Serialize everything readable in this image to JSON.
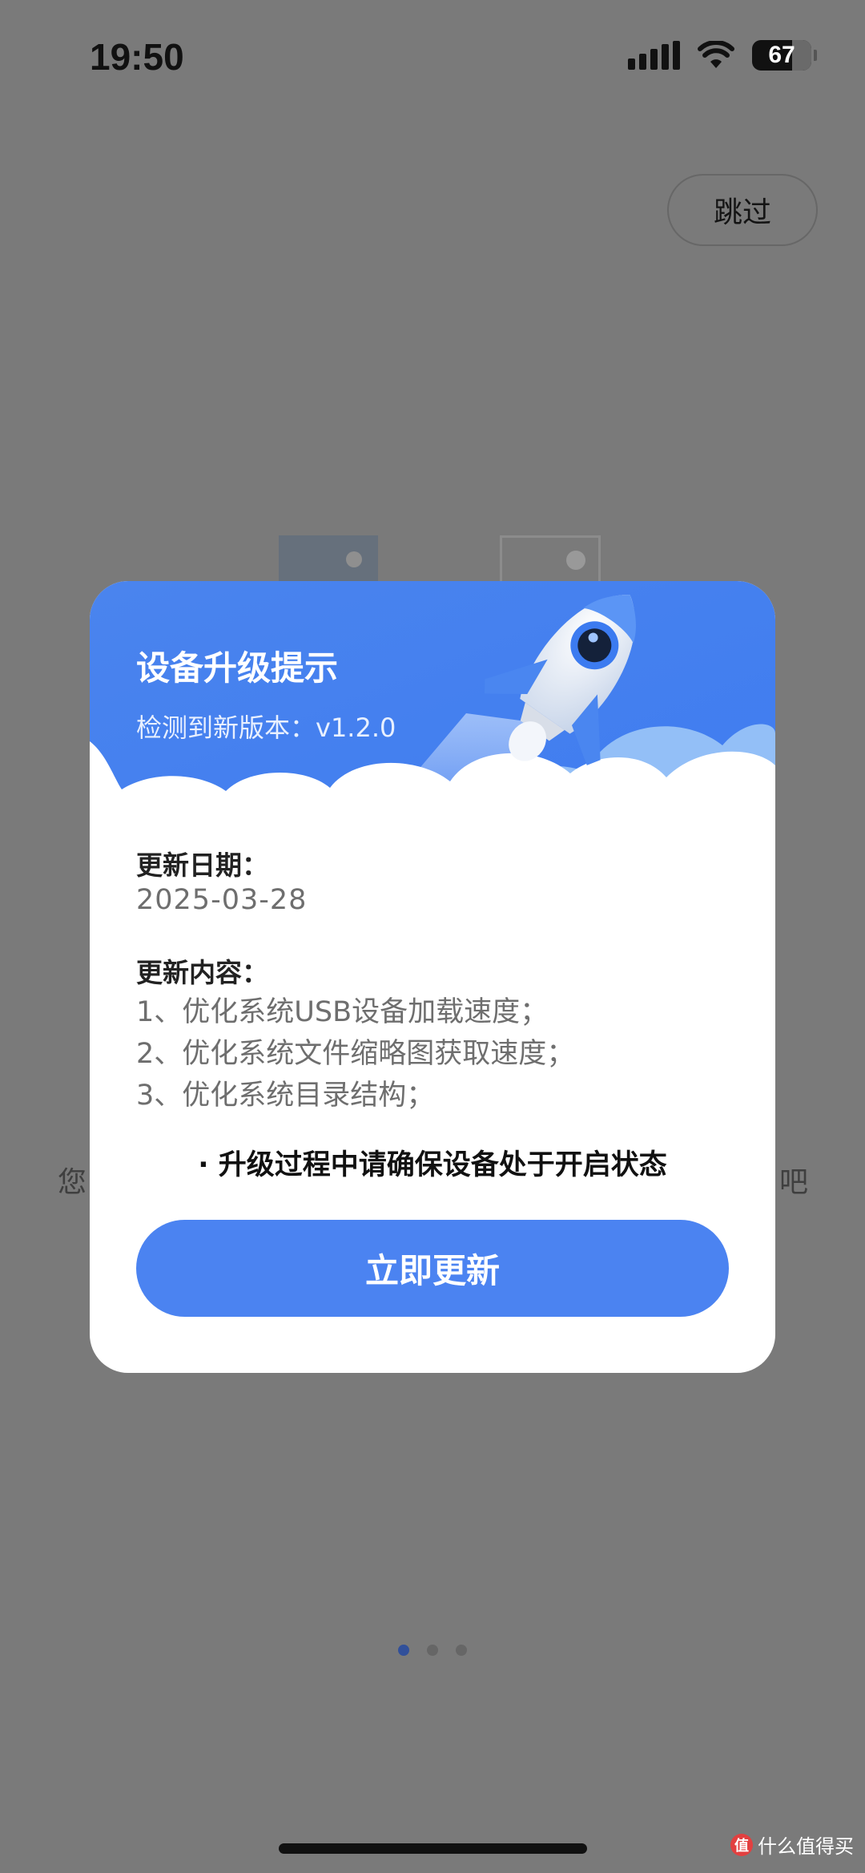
{
  "status_bar": {
    "time": "19:50",
    "battery": "67"
  },
  "skip_label": "跳过",
  "background": {
    "text_left": "您",
    "text_right": "吧"
  },
  "dialog": {
    "title": "设备升级提示",
    "subtitle": "检测到新版本：v1.2.0",
    "update_date_label": "更新日期：",
    "update_date": "2025-03-28",
    "update_content_label": "更新内容：",
    "update_items": [
      "1、优化系统USB设备加载速度；",
      "2、优化系统文件缩略图获取速度；",
      "3、优化系统目录结构；"
    ],
    "notice": "· 升级过程中请确保设备处于开启状态",
    "update_button": "立即更新"
  },
  "pager": {
    "count": 3,
    "active_index": 0
  },
  "watermark": {
    "logo_text": "值",
    "text": "什么值得买"
  },
  "colors": {
    "accent": "#4b83f1",
    "overlay": "#7a7a7a",
    "dialog_bg": "#ffffff"
  },
  "icons": [
    "signal-icon",
    "wifi-icon",
    "battery-icon",
    "rocket-icon",
    "cloud-illustration"
  ]
}
